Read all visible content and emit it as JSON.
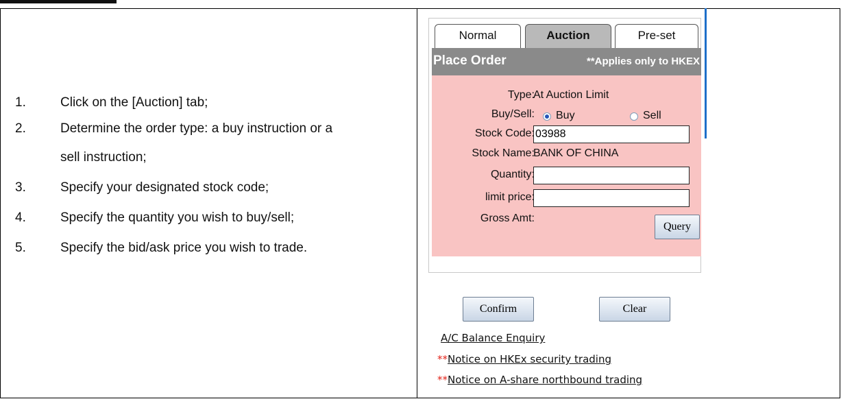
{
  "steps": [
    {
      "num": "1.",
      "text": "Click on the [Auction] tab;"
    },
    {
      "num": "2.",
      "text_line1": "Determine the order type: a buy instruction or a",
      "text_line2": "sell instruction;"
    },
    {
      "num": "3.",
      "text": "Specify your designated stock code;"
    },
    {
      "num": "4.",
      "text": "Specify the quantity you wish to buy/sell;"
    },
    {
      "num": "5.",
      "text": "Specify the bid/ask price you wish to trade."
    }
  ],
  "tabs": {
    "normal": "Normal",
    "auction": "Auction",
    "preset": "Pre-set",
    "active": "Auction"
  },
  "order": {
    "title": "Place Order",
    "note": "**Applies only to HKEX",
    "type_label": "Type:",
    "type_value": "At Auction Limit",
    "buysell_label": "Buy/Sell:",
    "buy_label": "Buy",
    "sell_label": "Sell",
    "selected_side": "Buy",
    "stock_code_label": "Stock Code:",
    "stock_code_value": "03988",
    "stock_name_label": "Stock Name:",
    "stock_name_value": "BANK OF CHINA",
    "quantity_label": "Quantity:",
    "quantity_value": "",
    "limit_price_label": "limit price:",
    "limit_price_value": "",
    "gross_amt_label": "Gross Amt:",
    "query_label": "Query"
  },
  "actions": {
    "confirm_label": "Confirm",
    "clear_label": "Clear"
  },
  "links": {
    "balance": "A/C Balance Enquiry",
    "hkex_stars": "**",
    "hkex": "Notice on HKEx security trading",
    "ashare_stars": "**",
    "ashare": "Notice on A-share northbound trading"
  },
  "colors": {
    "pink_panel": "#f9c4c3",
    "header_gray": "#8a8a8a",
    "active_tab": "#b9b9b9",
    "stars_red": "#e2231a",
    "accent_blue": "#1e6fc9"
  }
}
